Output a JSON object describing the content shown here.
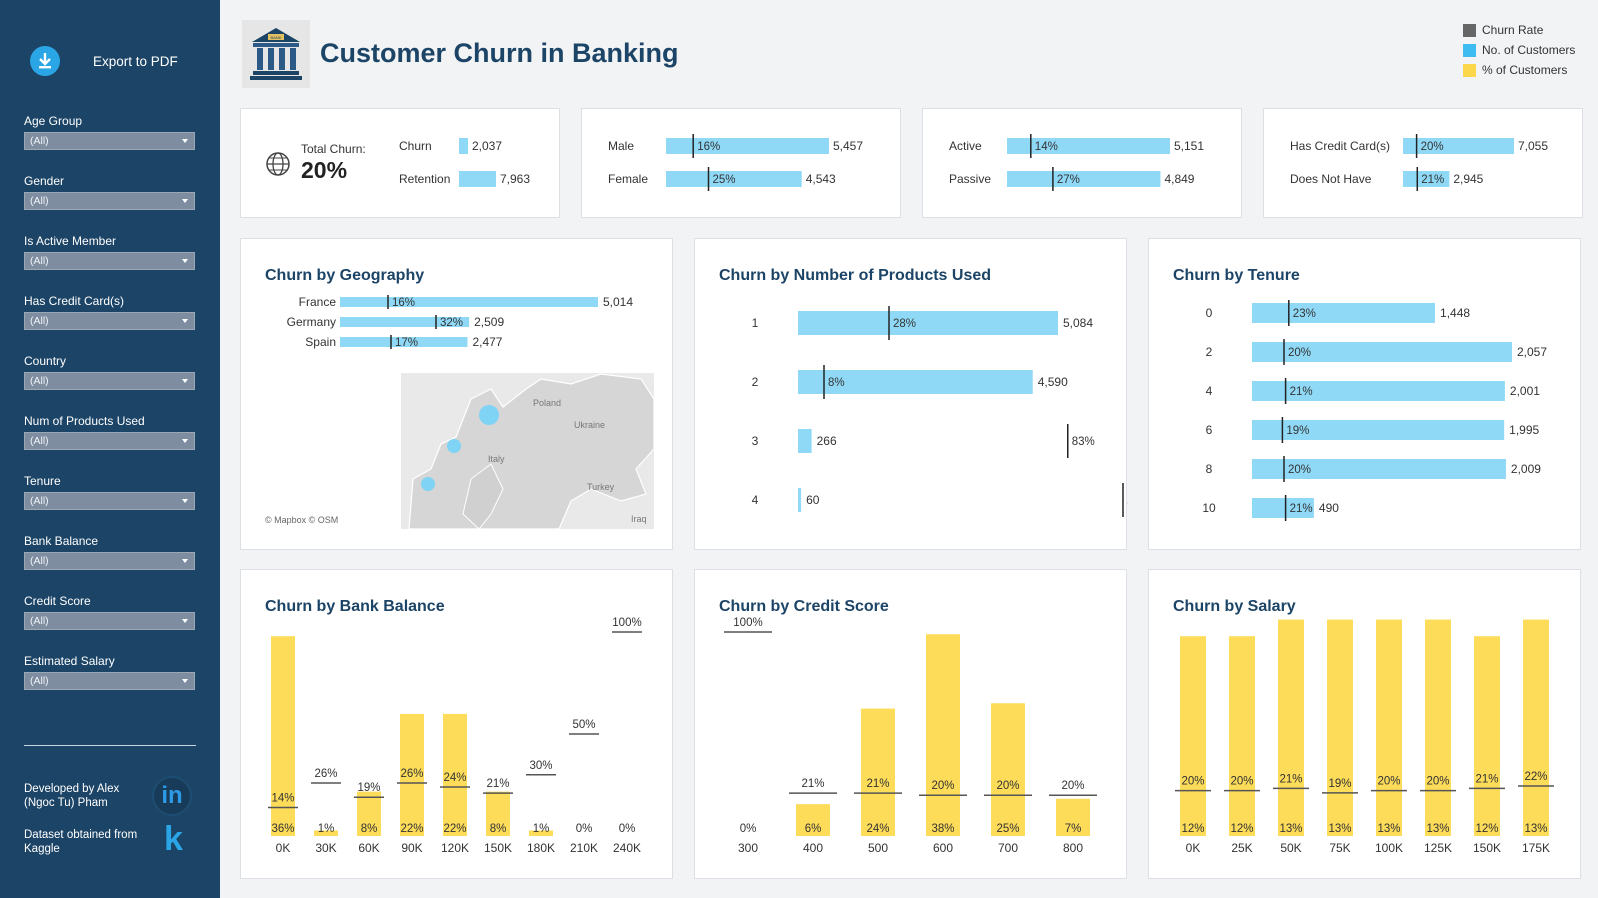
{
  "sidebar": {
    "export_label": "Export to PDF",
    "filters": [
      {
        "label": "Age Group",
        "value": "(All)"
      },
      {
        "label": "Gender",
        "value": "(All)"
      },
      {
        "label": "Is Active Member",
        "value": "(All)"
      },
      {
        "label": "Has Credit Card(s)",
        "value": "(All)"
      },
      {
        "label": "Country",
        "value": "(All)"
      },
      {
        "label": "Num of Products Used",
        "value": "(All)"
      },
      {
        "label": "Tenure",
        "value": "(All)"
      },
      {
        "label": "Bank Balance",
        "value": "(All)"
      },
      {
        "label": "Credit Score",
        "value": "(All)"
      },
      {
        "label": "Estimated Salary",
        "value": "(All)"
      }
    ],
    "developer": "Developed by Alex (Ngoc Tu) Pham",
    "dataset": "Dataset obtained from Kaggle",
    "linkedin_icon": "linkedin-icon",
    "kaggle_icon": "kaggle-icon"
  },
  "header": {
    "title": "Customer Churn in Banking",
    "logo_icon": "bank-icon",
    "logo_text": "BANK"
  },
  "legend": [
    {
      "label": "Churn Rate",
      "color": "#666666"
    },
    {
      "label": "No. of Customers",
      "color": "#3cbcf0"
    },
    {
      "label": "% of Customers",
      "color": "#fcd74c"
    }
  ],
  "colors": {
    "blue_bar": "#8fd9f7",
    "yellow_bar": "#fddc5a",
    "marker": "#222222",
    "title": "#1c4466"
  },
  "kpis": {
    "total_label": "Total Churn:",
    "total_value": "20%",
    "total_icon": "globe-icon",
    "groups": [
      {
        "rows": [
          {
            "label": "Churn",
            "count": 2037
          },
          {
            "label": "Retention",
            "count": 7963
          }
        ]
      },
      {
        "rows": [
          {
            "label": "Male",
            "rate": 16,
            "count": 5457
          },
          {
            "label": "Female",
            "rate": 25,
            "count": 4543
          }
        ]
      },
      {
        "rows": [
          {
            "label": "Active",
            "rate": 14,
            "count": 5151
          },
          {
            "label": "Passive",
            "rate": 27,
            "count": 4849
          }
        ]
      },
      {
        "rows": [
          {
            "label": "Has Credit Card(s)",
            "rate": 20,
            "count": 7055
          },
          {
            "label": "Does Not Have",
            "rate": 21,
            "count": 2945
          }
        ]
      }
    ]
  },
  "chart_data": [
    {
      "type": "bar",
      "title": "Churn by Geography",
      "categories": [
        "France",
        "Germany",
        "Spain"
      ],
      "series": [
        {
          "name": "No. of Customers",
          "values": [
            5014,
            2509,
            2477
          ]
        },
        {
          "name": "Churn Rate",
          "values": [
            16,
            32,
            17
          ]
        }
      ],
      "map_labels": [
        "Poland",
        "Ukraine",
        "Italy",
        "Turkey",
        "Iraq"
      ],
      "map_credit": "© Mapbox  © OSM"
    },
    {
      "type": "bar",
      "title": "Churn by Number of Products Used",
      "categories": [
        "1",
        "2",
        "3",
        "4"
      ],
      "series": [
        {
          "name": "No. of Customers",
          "values": [
            5084,
            4590,
            266,
            60
          ]
        },
        {
          "name": "Churn Rate",
          "values": [
            28,
            8,
            83,
            100
          ]
        }
      ]
    },
    {
      "type": "bar",
      "title": "Churn by Tenure",
      "categories": [
        "0",
        "2",
        "4",
        "6",
        "8",
        "10"
      ],
      "series": [
        {
          "name": "No. of Customers",
          "values": [
            1448,
            2057,
            2001,
            1995,
            2009,
            490
          ]
        },
        {
          "name": "Churn Rate",
          "values": [
            23,
            20,
            21,
            19,
            20,
            21
          ]
        }
      ]
    },
    {
      "type": "bar",
      "title": "Churn by Bank Balance",
      "categories": [
        "0K",
        "30K",
        "60K",
        "90K",
        "120K",
        "150K",
        "180K",
        "210K",
        "240K"
      ],
      "series": [
        {
          "name": "% of Customers",
          "values": [
            36,
            1,
            8,
            22,
            22,
            8,
            1,
            0,
            0
          ]
        },
        {
          "name": "Churn Rate",
          "values": [
            14,
            26,
            19,
            26,
            24,
            21,
            30,
            50,
            100
          ]
        }
      ]
    },
    {
      "type": "bar",
      "title": "Churn by Credit Score",
      "categories": [
        "300",
        "400",
        "500",
        "600",
        "700",
        "800"
      ],
      "series": [
        {
          "name": "% of Customers",
          "values": [
            0,
            6,
            24,
            38,
            25,
            7
          ]
        },
        {
          "name": "Churn Rate",
          "values": [
            100,
            21,
            21,
            20,
            20,
            20
          ]
        }
      ]
    },
    {
      "type": "bar",
      "title": "Churn by Salary",
      "categories": [
        "0K",
        "25K",
        "50K",
        "75K",
        "100K",
        "125K",
        "150K",
        "175K"
      ],
      "series": [
        {
          "name": "% of Customers",
          "values": [
            12,
            12,
            13,
            13,
            13,
            13,
            12,
            13
          ]
        },
        {
          "name": "Churn Rate",
          "values": [
            20,
            20,
            21,
            19,
            20,
            20,
            21,
            22
          ]
        }
      ]
    }
  ]
}
